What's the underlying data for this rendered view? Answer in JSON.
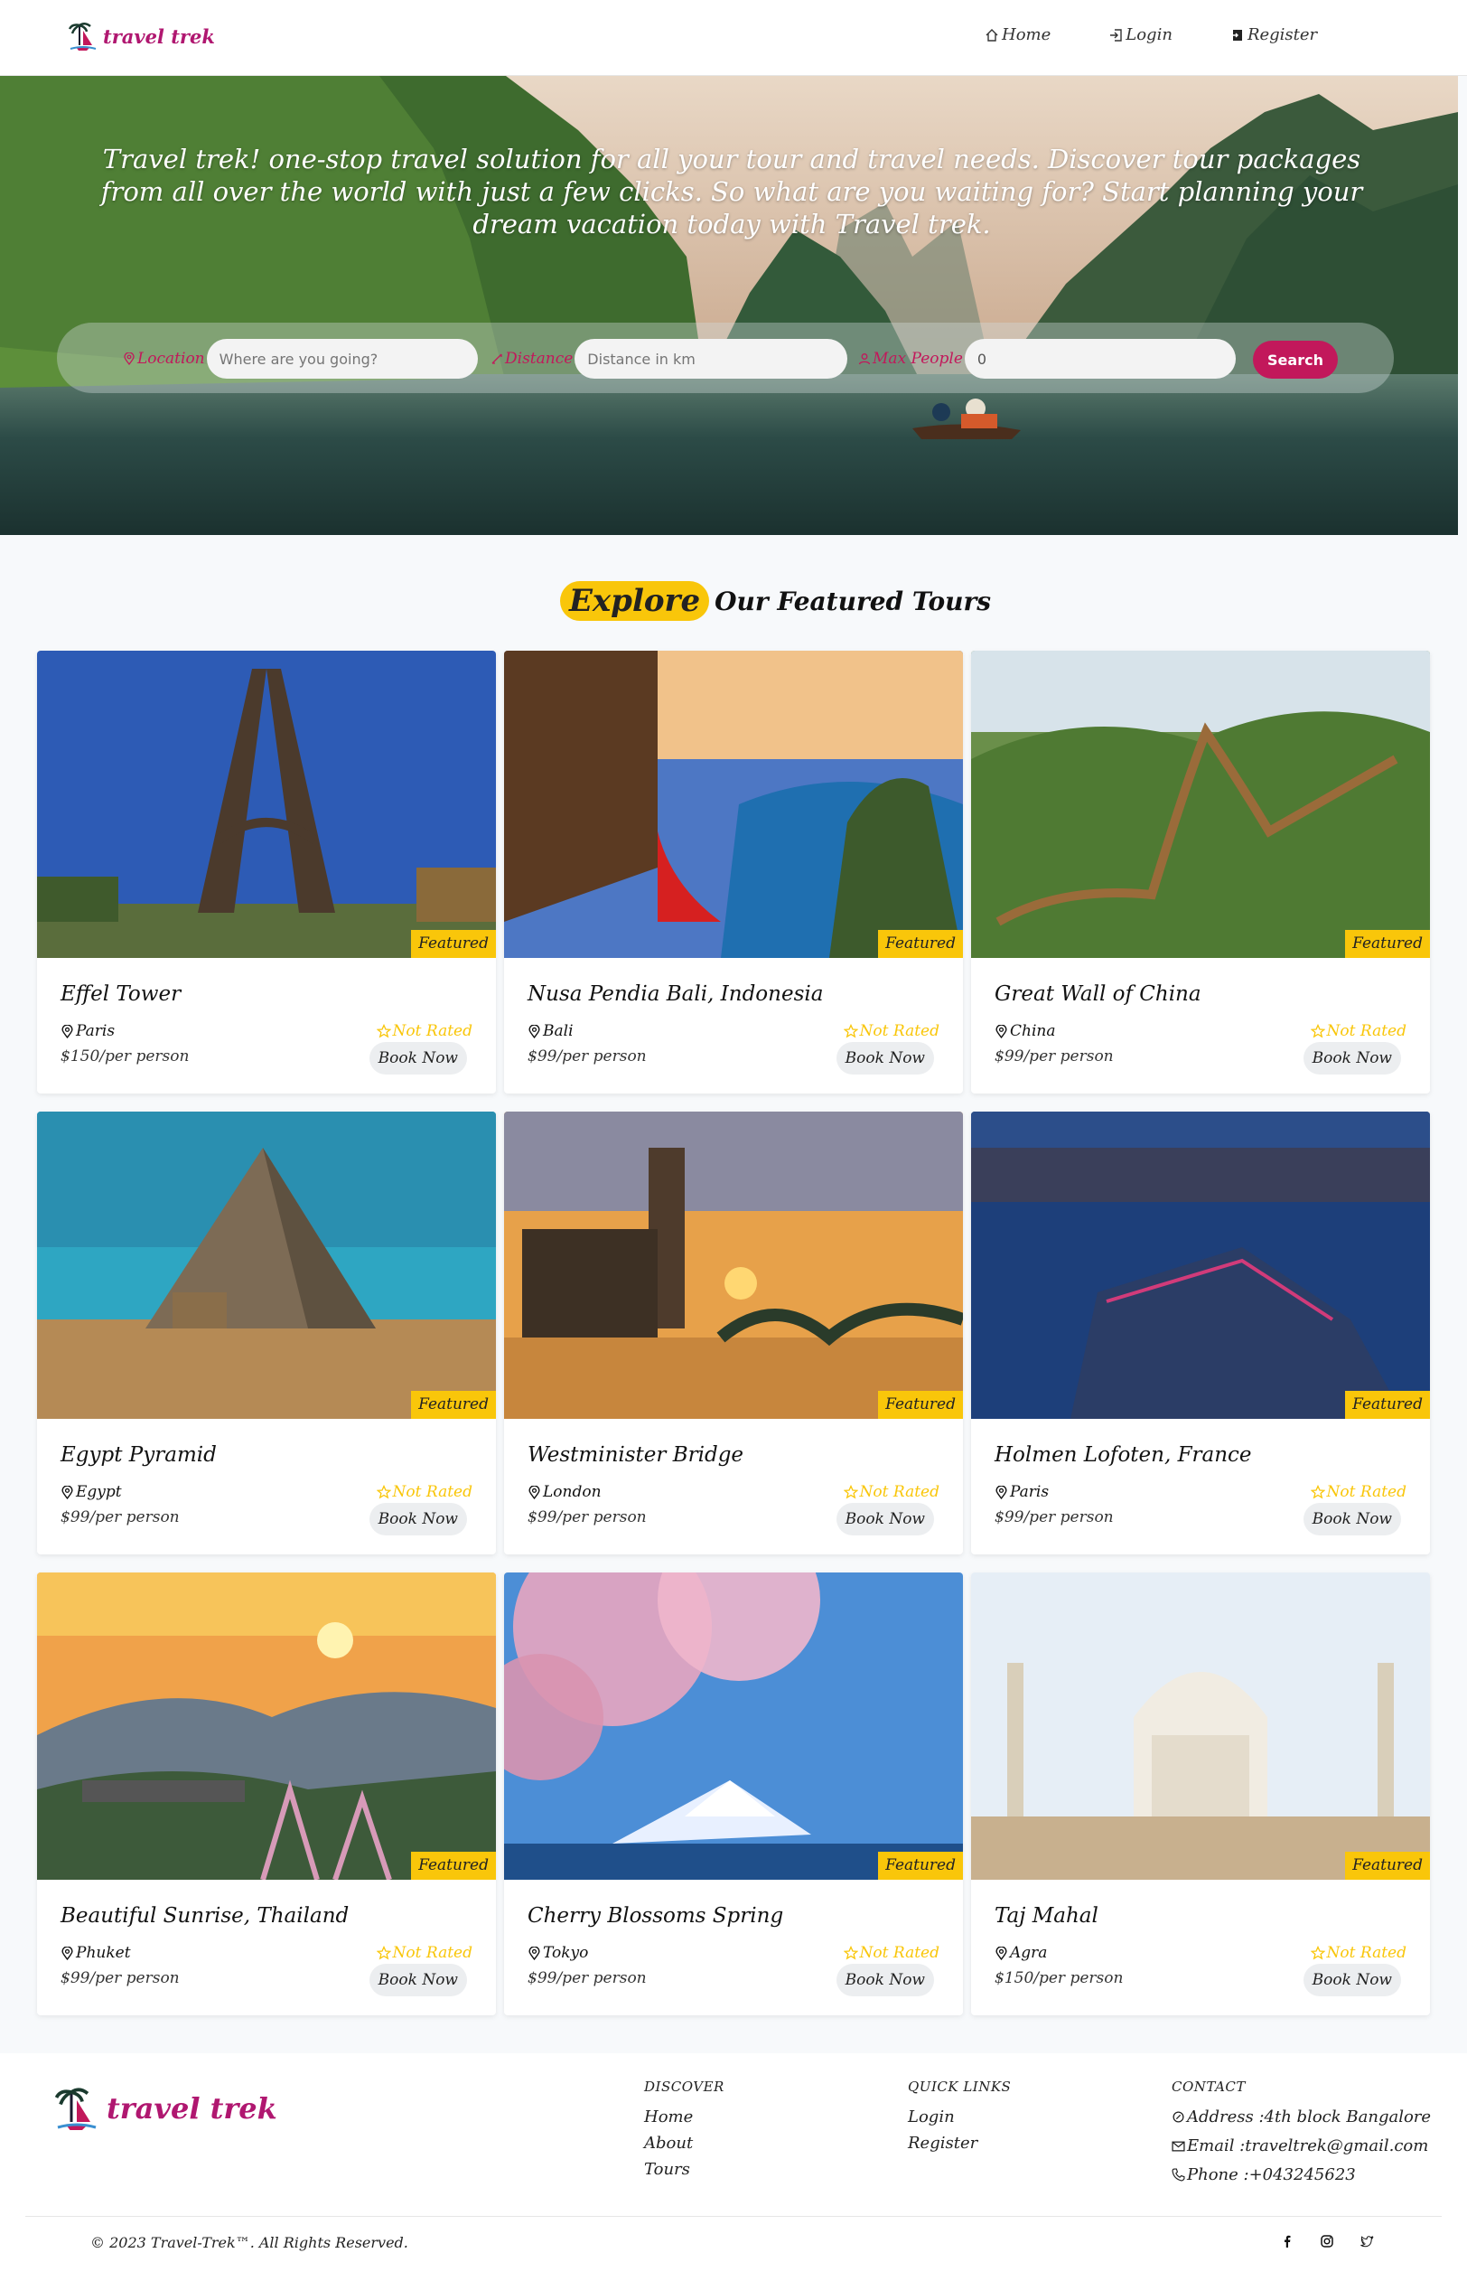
{
  "brand": {
    "name": "travel trek"
  },
  "nav": {
    "items": [
      {
        "label": "Home",
        "icon": "home-icon"
      },
      {
        "label": "Login",
        "icon": "login-icon"
      },
      {
        "label": "Register",
        "icon": "register-icon"
      }
    ]
  },
  "hero": {
    "tagline": "Travel trek! one-stop travel solution for all your tour and travel needs. Discover tour packages from all over the world with just a few clicks. So what are you waiting for? Start planning your dream vacation today with Travel trek."
  },
  "search": {
    "location_label": "Location",
    "location_placeholder": "Where are you going?",
    "distance_label": "Distance",
    "distance_placeholder": "Distance in km",
    "people_label": "Max People",
    "people_value": "0",
    "button_label": "Search"
  },
  "section": {
    "highlight": "Explore",
    "title": "Our Featured Tours"
  },
  "tours": [
    {
      "title": "Effel Tower",
      "city": "Paris",
      "price": "$150",
      "per": "/per person",
      "rating": "Not Rated",
      "badge": "Featured",
      "book": "Book Now"
    },
    {
      "title": "Nusa Pendia Bali, Indonesia",
      "city": "Bali",
      "price": "$99",
      "per": "/per person",
      "rating": "Not Rated",
      "badge": "Featured",
      "book": "Book Now"
    },
    {
      "title": "Great Wall of China",
      "city": "China",
      "price": "$99",
      "per": "/per person",
      "rating": "Not Rated",
      "badge": "Featured",
      "book": "Book Now"
    },
    {
      "title": "Egypt Pyramid",
      "city": "Egypt",
      "price": "$99",
      "per": "/per person",
      "rating": "Not Rated",
      "badge": "Featured",
      "book": "Book Now"
    },
    {
      "title": "Westminister Bridge",
      "city": "London",
      "price": "$99",
      "per": "/per person",
      "rating": "Not Rated",
      "badge": "Featured",
      "book": "Book Now"
    },
    {
      "title": "Holmen Lofoten, France",
      "city": "Paris",
      "price": "$99",
      "per": "/per person",
      "rating": "Not Rated",
      "badge": "Featured",
      "book": "Book Now"
    },
    {
      "title": "Beautiful Sunrise, Thailand",
      "city": "Phuket",
      "price": "$99",
      "per": "/per person",
      "rating": "Not Rated",
      "badge": "Featured",
      "book": "Book Now"
    },
    {
      "title": "Cherry Blossoms Spring",
      "city": "Tokyo",
      "price": "$99",
      "per": "/per person",
      "rating": "Not Rated",
      "badge": "Featured",
      "book": "Book Now"
    },
    {
      "title": "Taj Mahal",
      "city": "Agra",
      "price": "$150",
      "per": "/per person",
      "rating": "Not Rated",
      "badge": "Featured",
      "book": "Book Now"
    }
  ],
  "footer": {
    "discover_head": "DISCOVER",
    "discover": [
      "Home",
      "About",
      "Tours"
    ],
    "quick_head": "QUICK LINKS",
    "quick": [
      "Login",
      "Register"
    ],
    "contact_head": "CONTACT",
    "address": "Address :4th block Bangalore",
    "email": "Email :traveltrek@gmail.com",
    "phone": "Phone :+043245623",
    "copyright": "© 2023 Travel-Trek™. All Rights Reserved.",
    "social": [
      "facebook-icon",
      "instagram-icon",
      "twitter-icon"
    ]
  },
  "colors": {
    "accent": "#c2185b",
    "brand": "#b01770",
    "highlight": "#f9c60a"
  }
}
